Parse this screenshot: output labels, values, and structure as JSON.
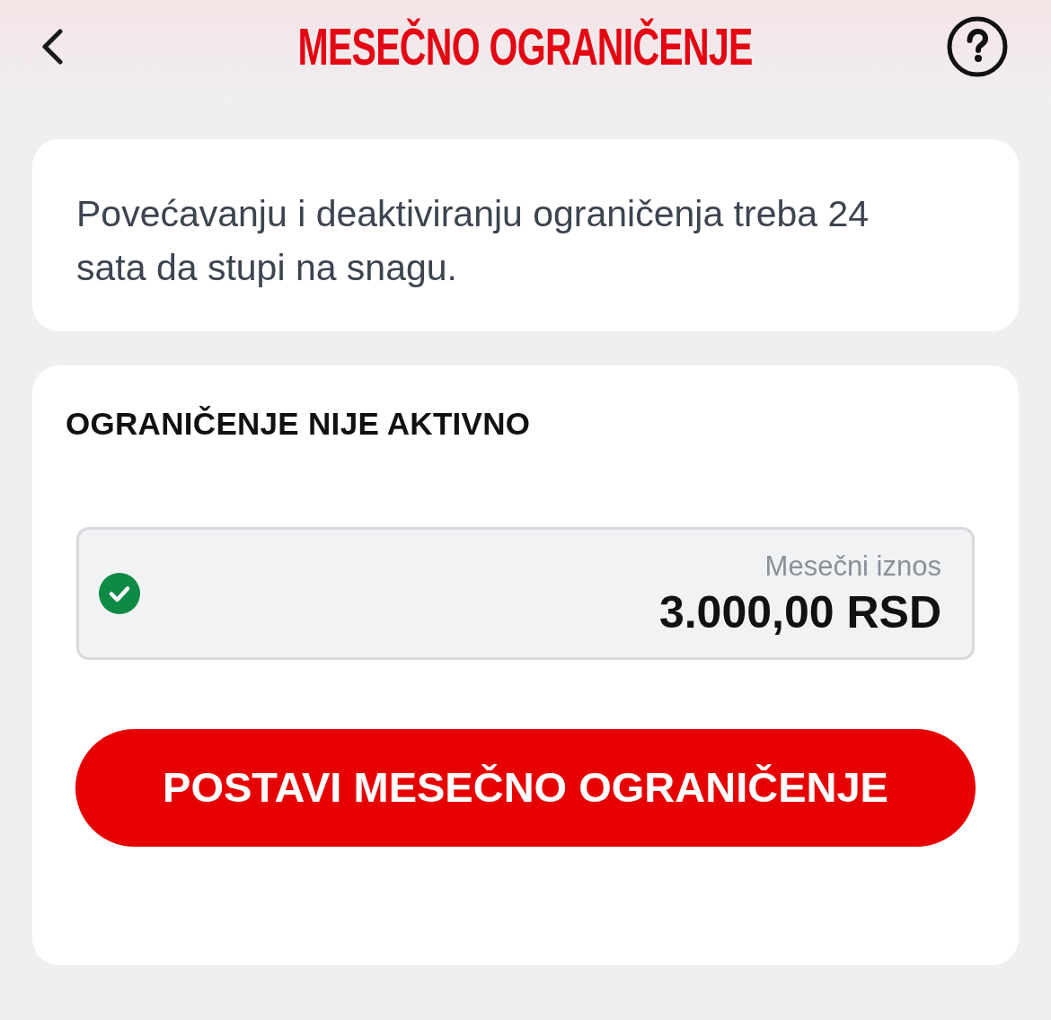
{
  "header": {
    "title": "MESEČNO OGRANIČENJE"
  },
  "info_card": {
    "text": "Povećavanju i deaktiviranju ograničenja treba 24 sata da stupi na snagu."
  },
  "limit_card": {
    "status": "OGRANIČENJE NIJE AKTIVNO",
    "amount_field": {
      "label": "Mesečni iznos",
      "value": "3.000,00 RSD",
      "valid": true
    },
    "button": "POSTAVI MESEČNO OGRANIČENJE"
  }
}
